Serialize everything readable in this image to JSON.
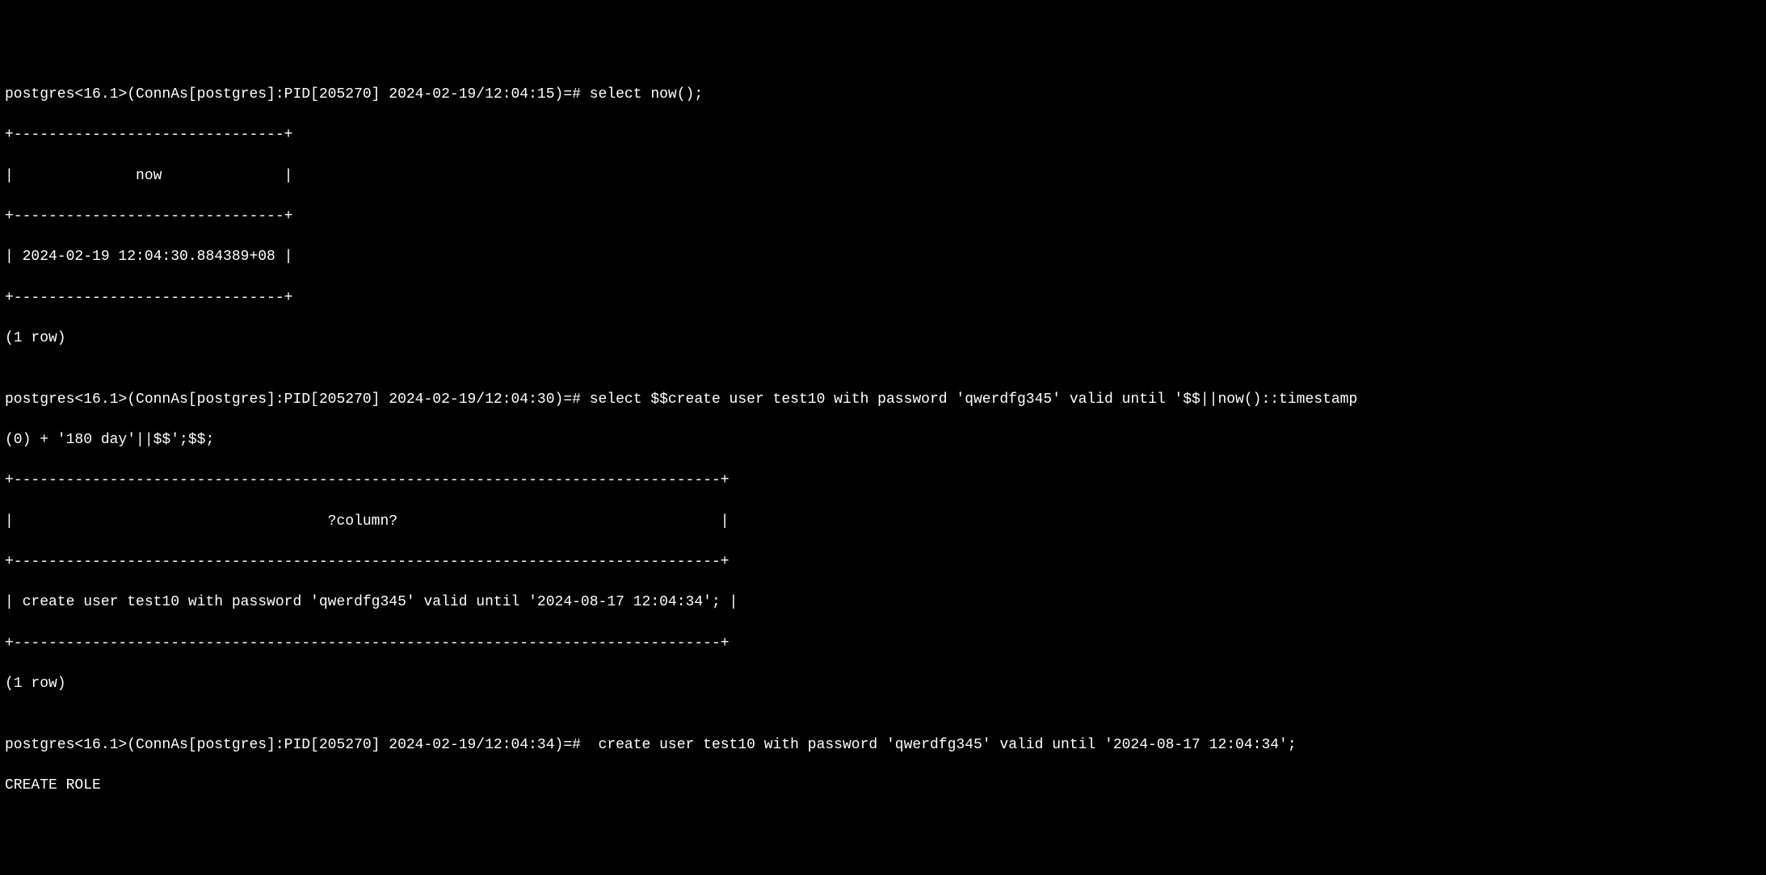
{
  "lines": {
    "l1": "postgres<16.1>(ConnAs[postgres]:PID[205270] 2024-02-19/12:04:15)=# select now();",
    "l2": "+-------------------------------+",
    "l3": "|              now              |",
    "l4": "+-------------------------------+",
    "l5": "| 2024-02-19 12:04:30.884389+08 |",
    "l6": "+-------------------------------+",
    "l7": "(1 row)",
    "l8": "",
    "l9": "postgres<16.1>(ConnAs[postgres]:PID[205270] 2024-02-19/12:04:30)=# select $$create user test10 with password 'qwerdfg345' valid until '$$||now()::timestamp",
    "l10": "(0) + '180 day'||$$';$$;",
    "l11": "+---------------------------------------------------------------------------------+",
    "l12": "|                                    ?column?                                     |",
    "l13": "+---------------------------------------------------------------------------------+",
    "l14": "| create user test10 with password 'qwerdfg345' valid until '2024-08-17 12:04:34'; |",
    "l15": "+---------------------------------------------------------------------------------+",
    "l16": "(1 row)",
    "l17": "",
    "l18": "postgres<16.1>(ConnAs[postgres]:PID[205270] 2024-02-19/12:04:34)=#  create user test10 with password 'qwerdfg345' valid until '2024-08-17 12:04:34';",
    "l19": "CREATE ROLE"
  }
}
